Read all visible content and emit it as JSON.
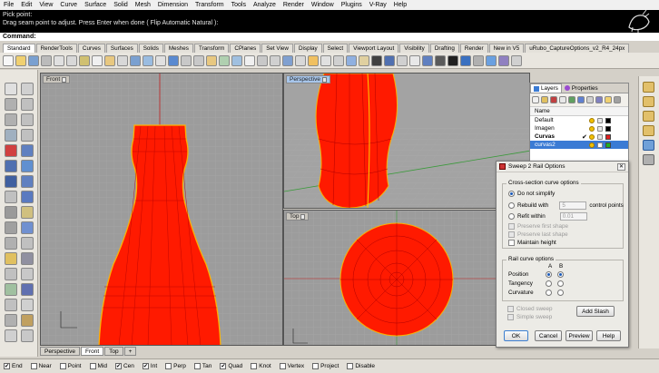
{
  "menubar": [
    "File",
    "Edit",
    "View",
    "Curve",
    "Surface",
    "Solid",
    "Mesh",
    "Dimension",
    "Transform",
    "Tools",
    "Analyze",
    "Render",
    "Window",
    "Plugins",
    "V-Ray",
    "Help"
  ],
  "command_history": [
    "Pick point:",
    "Drag seam point to adjust. Press Enter when done ( Flip  Automatic  Natural ):"
  ],
  "command_prompt": "Command:",
  "toolbar_tabs": [
    "Standard",
    "RenderTools",
    "Curves",
    "Surfaces",
    "Solids",
    "Meshes",
    "Transform",
    "CPlanes",
    "Set View",
    "Display",
    "Select",
    "Viewport Layout",
    "Visibility",
    "Drafting",
    "Render",
    "New in V5",
    "uRubo_CaptureOptions_v2_R4_24px"
  ],
  "viewports": {
    "front": "Front",
    "perspective": "Perspective",
    "top": "Top"
  },
  "viewport_tabs": [
    "Perspective",
    "Front",
    "Top",
    "+"
  ],
  "osnaps": [
    {
      "label": "End",
      "checked": true
    },
    {
      "label": "Near",
      "checked": false
    },
    {
      "label": "Point",
      "checked": false
    },
    {
      "label": "Mid",
      "checked": false
    },
    {
      "label": "Cen",
      "checked": true
    },
    {
      "label": "Int",
      "checked": true
    },
    {
      "label": "Perp",
      "checked": false
    },
    {
      "label": "Tan",
      "checked": false
    },
    {
      "label": "Quad",
      "checked": true
    },
    {
      "label": "Knot",
      "checked": false
    },
    {
      "label": "Vertex",
      "checked": false
    },
    {
      "label": "Project",
      "checked": false
    },
    {
      "label": "Disable",
      "checked": false
    }
  ],
  "layers_panel": {
    "tab_layers": "Layers",
    "tab_properties": "Properties",
    "column_name": "Name",
    "rows": [
      {
        "name": "Default",
        "current": false,
        "selected": false,
        "bold": false,
        "color": "#000000"
      },
      {
        "name": "Imagen",
        "current": false,
        "selected": false,
        "bold": false,
        "color": "#000000"
      },
      {
        "name": "Curvas",
        "current": true,
        "selected": false,
        "bold": true,
        "color": "#e02020"
      },
      {
        "name": "curvas2",
        "current": false,
        "selected": true,
        "bold": false,
        "color": "#20b020"
      }
    ]
  },
  "dialog": {
    "title": "Sweep 2 Rail Options",
    "cross_section_title": "Cross-section curve options",
    "do_not_simplify": "Do not simplify",
    "rebuild_with": "Rebuild with",
    "rebuild_value": "5",
    "control_points": "control points",
    "refit_within": "Refit within",
    "refit_value": "0.01",
    "preserve_first": "Preserve first shape",
    "preserve_last": "Preserve last shape",
    "maintain_height": "Maintain height",
    "rail_title": "Rail curve options",
    "col_a": "A",
    "col_b": "B",
    "position": "Position",
    "tangency": "Tangency",
    "curvature": "Curvature",
    "closed_sweep": "Closed sweep",
    "simple_sweep": "Simple sweep",
    "add_slash": "Add Slash",
    "ok": "OK",
    "cancel": "Cancel",
    "preview": "Preview",
    "help": "Help"
  },
  "colors": {
    "wire": "#ff1a00",
    "viewport_bg": "#9c9c9c",
    "selected_row": "#3b7bd4",
    "command_bg": "#000000"
  }
}
